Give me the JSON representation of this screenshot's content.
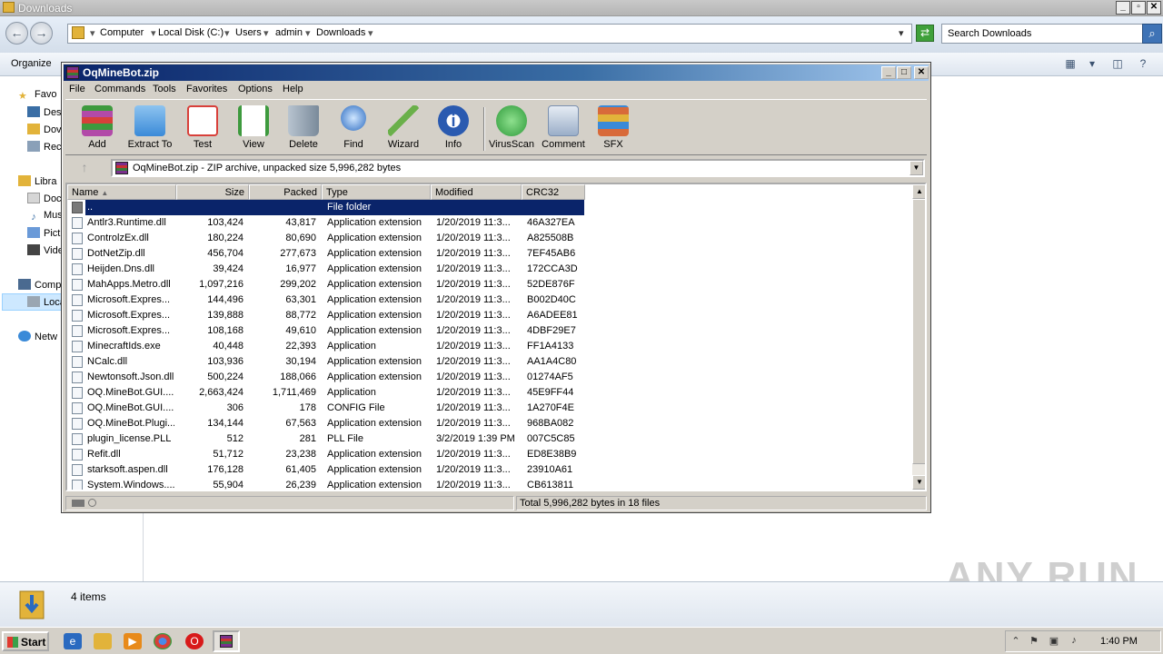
{
  "explorer": {
    "title": "Downloads",
    "breadcrumbs": [
      "Computer",
      "Local Disk (C:)",
      "Users",
      "admin",
      "Downloads"
    ],
    "search_placeholder": "Search Downloads",
    "organize": "Organize",
    "nav": [
      "Favo",
      "Des",
      "Dov",
      "Rec",
      "Libra",
      "Doc",
      "Mus",
      "Pict",
      "Vide",
      "Comp",
      "Loca",
      "Netw"
    ],
    "status_count": "4 items",
    "watermark": "ANY RUN"
  },
  "winrar": {
    "title": "OqMineBot.zip",
    "menu": [
      "File",
      "Commands",
      "Tools",
      "Favorites",
      "Options",
      "Help"
    ],
    "toolbar": [
      {
        "label": "Add",
        "icon": "add-icon",
        "color": "#b24aa8"
      },
      {
        "label": "Extract To",
        "icon": "extract-icon",
        "color": "#3a8ad8"
      },
      {
        "label": "Test",
        "icon": "test-icon",
        "color": "#d8403a"
      },
      {
        "label": "View",
        "icon": "view-icon",
        "color": "#3e9a3e"
      },
      {
        "label": "Delete",
        "icon": "delete-icon",
        "color": "#8a9aa8"
      },
      {
        "label": "Find",
        "icon": "find-icon",
        "color": "#2a6ac0"
      },
      {
        "label": "Wizard",
        "icon": "wizard-icon",
        "color": "#6ab04a"
      },
      {
        "label": "Info",
        "icon": "info-icon",
        "color": "#2a5ab0"
      },
      {
        "label": "VirusScan",
        "icon": "virusscan-icon",
        "color": "#2e9a3a"
      },
      {
        "label": "Comment",
        "icon": "comment-icon",
        "color": "#7a90b0"
      },
      {
        "label": "SFX",
        "icon": "sfx-icon",
        "color": "#d86a3a"
      }
    ],
    "path": "OqMineBot.zip - ZIP archive, unpacked size 5,996,282 bytes",
    "columns": [
      "Name",
      "Size",
      "Packed",
      "Type",
      "Modified",
      "CRC32"
    ],
    "rows": [
      {
        "name": "..",
        "size": "",
        "packed": "",
        "type": "File folder",
        "modified": "",
        "crc": "",
        "selected": true
      },
      {
        "name": "Antlr3.Runtime.dll",
        "size": "103,424",
        "packed": "43,817",
        "type": "Application extension",
        "modified": "1/20/2019 11:3...",
        "crc": "46A327EA"
      },
      {
        "name": "ControlzEx.dll",
        "size": "180,224",
        "packed": "80,690",
        "type": "Application extension",
        "modified": "1/20/2019 11:3...",
        "crc": "A825508B"
      },
      {
        "name": "DotNetZip.dll",
        "size": "456,704",
        "packed": "277,673",
        "type": "Application extension",
        "modified": "1/20/2019 11:3...",
        "crc": "7EF45AB6"
      },
      {
        "name": "Heijden.Dns.dll",
        "size": "39,424",
        "packed": "16,977",
        "type": "Application extension",
        "modified": "1/20/2019 11:3...",
        "crc": "172CCA3D"
      },
      {
        "name": "MahApps.Metro.dll",
        "size": "1,097,216",
        "packed": "299,202",
        "type": "Application extension",
        "modified": "1/20/2019 11:3...",
        "crc": "52DE876F"
      },
      {
        "name": "Microsoft.Expres...",
        "size": "144,496",
        "packed": "63,301",
        "type": "Application extension",
        "modified": "1/20/2019 11:3...",
        "crc": "B002D40C"
      },
      {
        "name": "Microsoft.Expres...",
        "size": "139,888",
        "packed": "88,772",
        "type": "Application extension",
        "modified": "1/20/2019 11:3...",
        "crc": "A6ADEE81"
      },
      {
        "name": "Microsoft.Expres...",
        "size": "108,168",
        "packed": "49,610",
        "type": "Application extension",
        "modified": "1/20/2019 11:3...",
        "crc": "4DBF29E7"
      },
      {
        "name": "MinecraftIds.exe",
        "size": "40,448",
        "packed": "22,393",
        "type": "Application",
        "modified": "1/20/2019 11:3...",
        "crc": "FF1A4133"
      },
      {
        "name": "NCalc.dll",
        "size": "103,936",
        "packed": "30,194",
        "type": "Application extension",
        "modified": "1/20/2019 11:3...",
        "crc": "AA1A4C80"
      },
      {
        "name": "Newtonsoft.Json.dll",
        "size": "500,224",
        "packed": "188,066",
        "type": "Application extension",
        "modified": "1/20/2019 11:3...",
        "crc": "01274AF5"
      },
      {
        "name": "OQ.MineBot.GUI....",
        "size": "2,663,424",
        "packed": "1,711,469",
        "type": "Application",
        "modified": "1/20/2019 11:3...",
        "crc": "45E9FF44"
      },
      {
        "name": "OQ.MineBot.GUI....",
        "size": "306",
        "packed": "178",
        "type": "CONFIG File",
        "modified": "1/20/2019 11:3...",
        "crc": "1A270F4E"
      },
      {
        "name": "OQ.MineBot.Plugi...",
        "size": "134,144",
        "packed": "67,563",
        "type": "Application extension",
        "modified": "1/20/2019 11:3...",
        "crc": "968BA082"
      },
      {
        "name": "plugin_license.PLL",
        "size": "512",
        "packed": "281",
        "type": "PLL File",
        "modified": "3/2/2019 1:39 PM",
        "crc": "007C5C85"
      },
      {
        "name": "Refit.dll",
        "size": "51,712",
        "packed": "23,238",
        "type": "Application extension",
        "modified": "1/20/2019 11:3...",
        "crc": "ED8E38B9"
      },
      {
        "name": "starksoft.aspen.dll",
        "size": "176,128",
        "packed": "61,405",
        "type": "Application extension",
        "modified": "1/20/2019 11:3...",
        "crc": "23910A61"
      },
      {
        "name": "System.Windows....",
        "size": "55,904",
        "packed": "26,239",
        "type": "Application extension",
        "modified": "1/20/2019 11:3...",
        "crc": "CB613811"
      }
    ],
    "status_total": "Total 5,996,282 bytes in 18 files"
  },
  "taskbar": {
    "start": "Start",
    "clock": "1:40 PM"
  }
}
